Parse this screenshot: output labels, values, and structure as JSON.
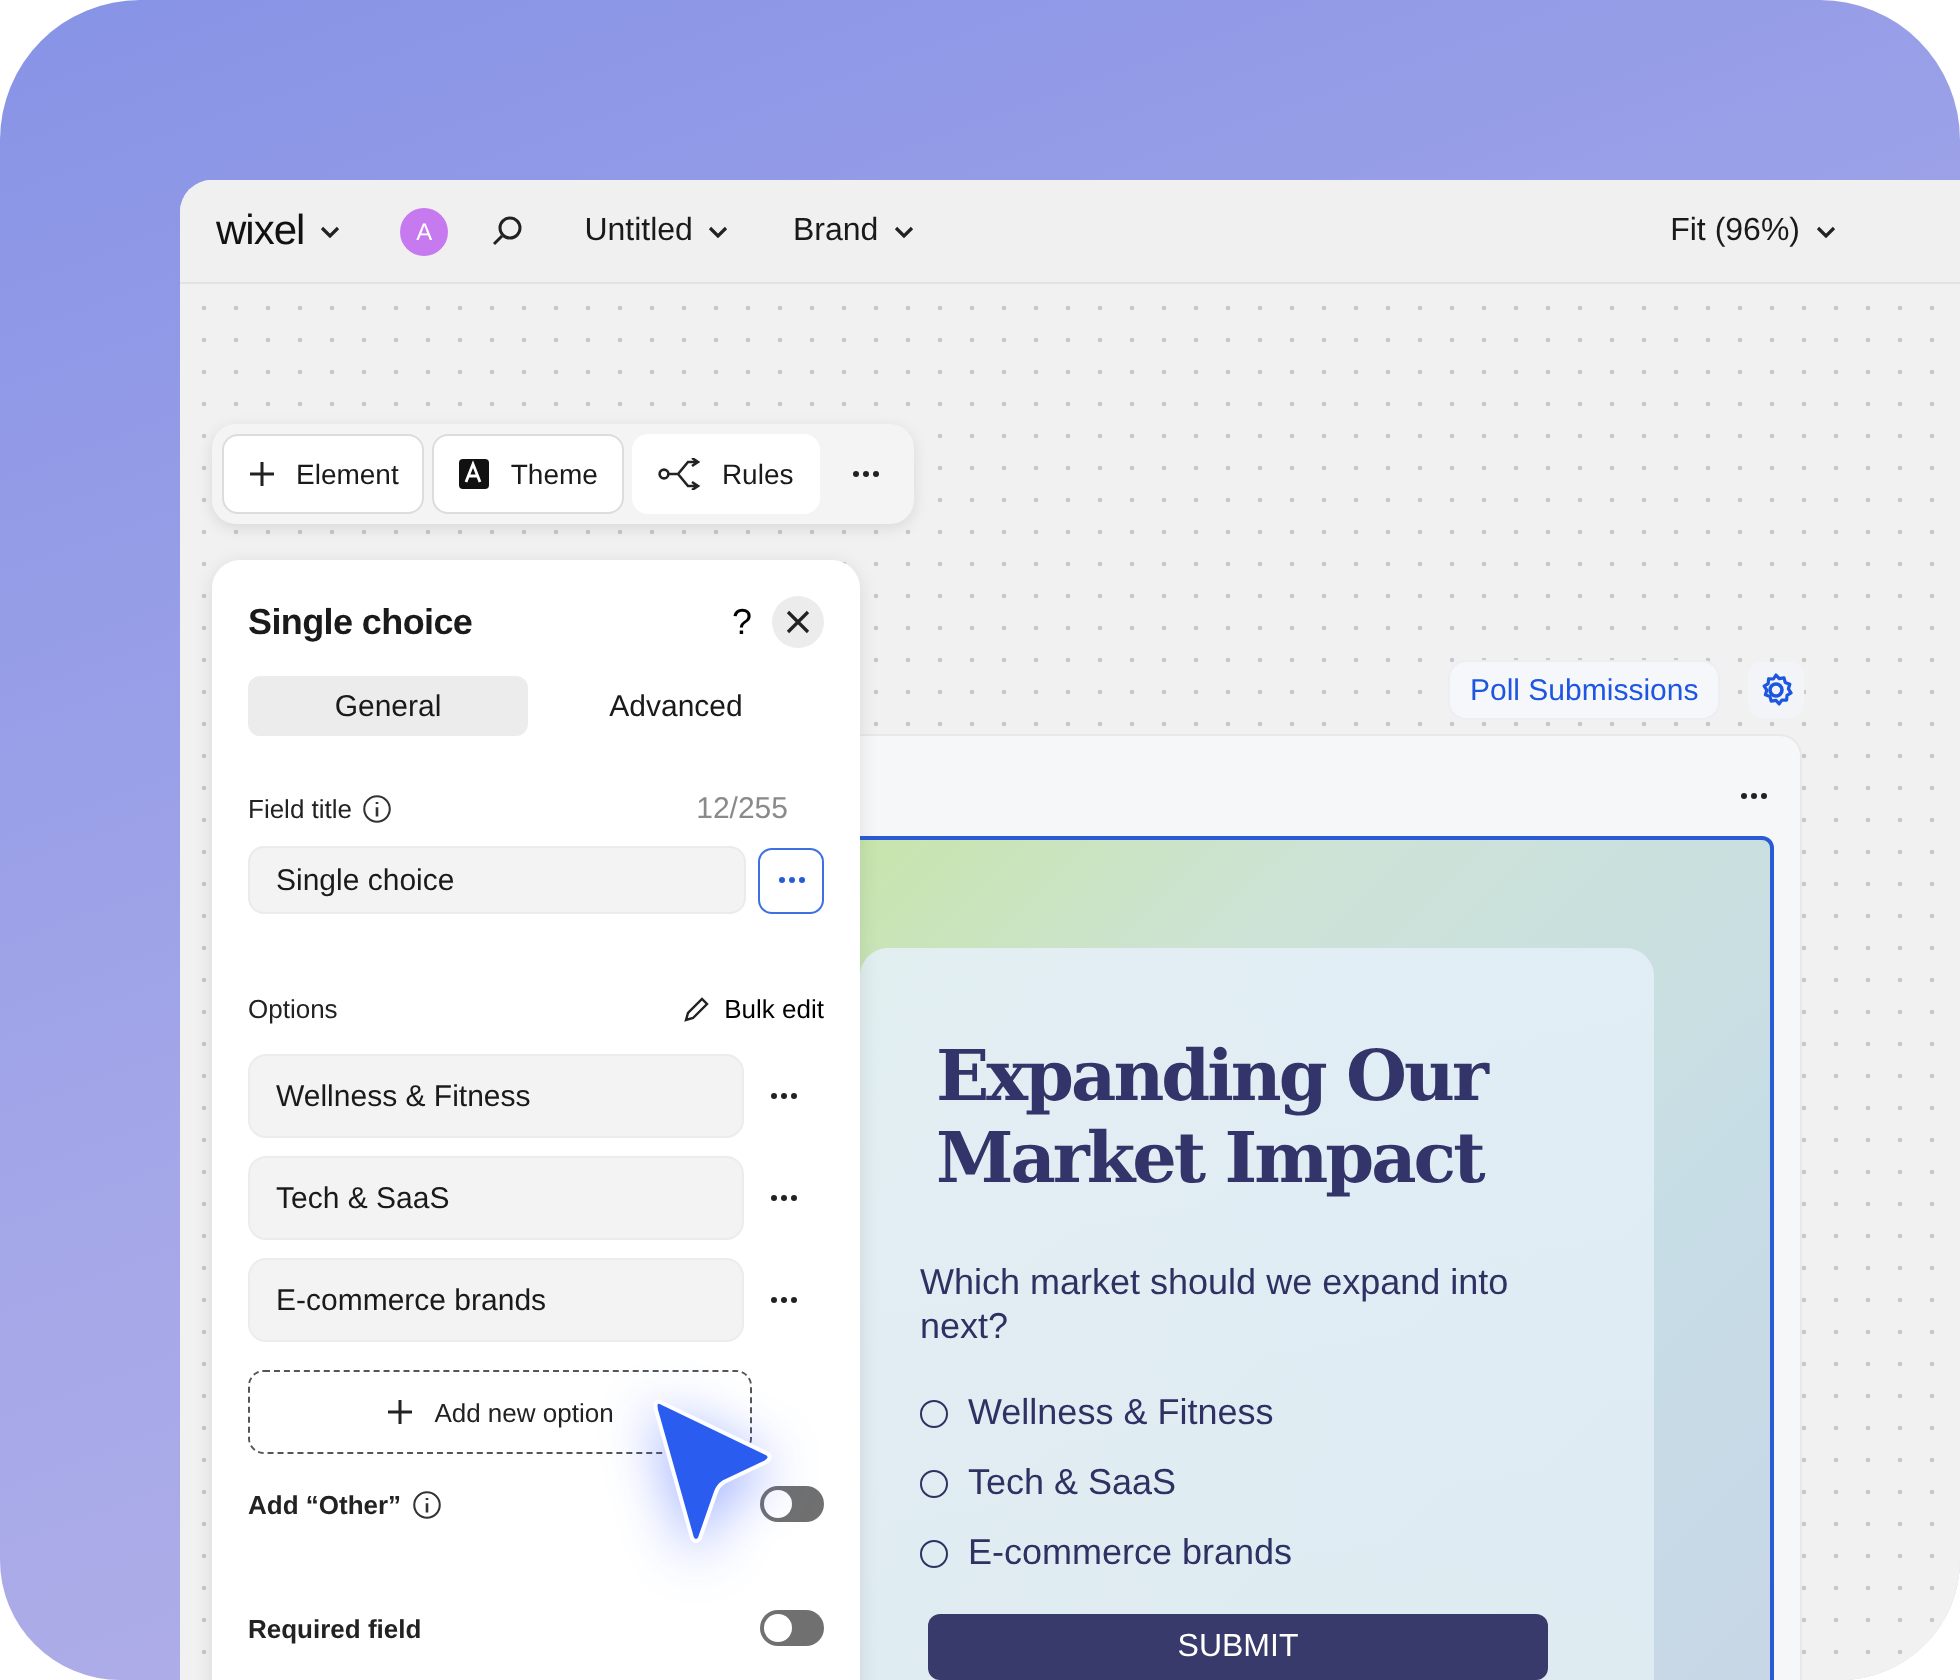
{
  "topbar": {
    "logo": "wixel",
    "avatar": "A",
    "menus": [
      {
        "label": "Untitled"
      },
      {
        "label": "Brand"
      }
    ],
    "zoom": "Fit (96%)"
  },
  "toolbar": {
    "items": [
      {
        "kind": "add",
        "label": "Element"
      },
      {
        "kind": "theme",
        "label": "Theme"
      },
      {
        "kind": "rules",
        "label": "Rules"
      },
      {
        "kind": "more"
      }
    ]
  },
  "panel": {
    "title": "Single choice",
    "help": "?",
    "tabs": [
      {
        "label": "General",
        "selected": true
      },
      {
        "label": "Advanced",
        "selected": false
      }
    ],
    "field_title": {
      "label": "Field title",
      "counter": "12/255",
      "value": "Single choice"
    },
    "options_label": "Options",
    "bulk_edit": "Bulk edit",
    "options": [
      "Wellness & Fitness",
      "Tech & SaaS",
      "E-commerce brands"
    ],
    "add_option": "Add new option",
    "toggles": [
      {
        "label": "Add “Other”",
        "info": true,
        "on": false
      },
      {
        "label": "Required field",
        "info": false,
        "on": false
      }
    ]
  },
  "poll_button": "Poll Submissions",
  "form": {
    "title": "Expanding Our Market Impact",
    "question": "Which market should we expand into next?",
    "choices": [
      {
        "label": "Wellness & Fitness",
        "selected": false
      },
      {
        "label": "Tech & SaaS",
        "selected": false
      },
      {
        "label": "E-commerce brands",
        "selected": false
      }
    ],
    "submit": "SUBMIT"
  }
}
